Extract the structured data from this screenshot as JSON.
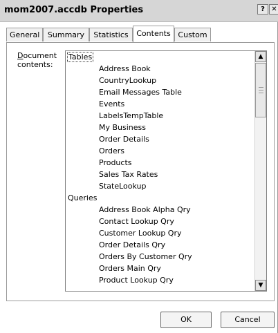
{
  "window": {
    "title": "mom2007.accdb Properties",
    "help_glyph": "?",
    "close_glyph": "✕"
  },
  "tabs": [
    {
      "label": "General"
    },
    {
      "label": "Summary"
    },
    {
      "label": "Statistics"
    },
    {
      "label": "Contents",
      "active": true
    },
    {
      "label": "Custom"
    }
  ],
  "contents": {
    "label_line1": "Document",
    "label_line2": "contents:",
    "label_mnemonic": "D",
    "rows": [
      {
        "text": "Tables",
        "kind": "group",
        "selected": true
      },
      {
        "text": "Address Book",
        "kind": "item"
      },
      {
        "text": "CountryLookup",
        "kind": "item"
      },
      {
        "text": "Email Messages Table",
        "kind": "item"
      },
      {
        "text": "Events",
        "kind": "item"
      },
      {
        "text": "LabelsTempTable",
        "kind": "item"
      },
      {
        "text": "My Business",
        "kind": "item"
      },
      {
        "text": "Order Details",
        "kind": "item"
      },
      {
        "text": "Orders",
        "kind": "item"
      },
      {
        "text": "Products",
        "kind": "item"
      },
      {
        "text": "Sales Tax Rates",
        "kind": "item"
      },
      {
        "text": "StateLookup",
        "kind": "item"
      },
      {
        "text": "Queries",
        "kind": "group"
      },
      {
        "text": "Address Book Alpha Qry",
        "kind": "item"
      },
      {
        "text": "Contact Lookup Qry",
        "kind": "item"
      },
      {
        "text": "Customer Lookup Qry",
        "kind": "item"
      },
      {
        "text": "Order Details Qry",
        "kind": "item"
      },
      {
        "text": "Orders By Customer Qry",
        "kind": "item"
      },
      {
        "text": "Orders Main Qry",
        "kind": "item"
      },
      {
        "text": "Product Lookup Qry",
        "kind": "item"
      }
    ],
    "scroll_up_glyph": "▲",
    "scroll_down_glyph": "▼"
  },
  "buttons": {
    "ok": "OK",
    "cancel": "Cancel"
  }
}
